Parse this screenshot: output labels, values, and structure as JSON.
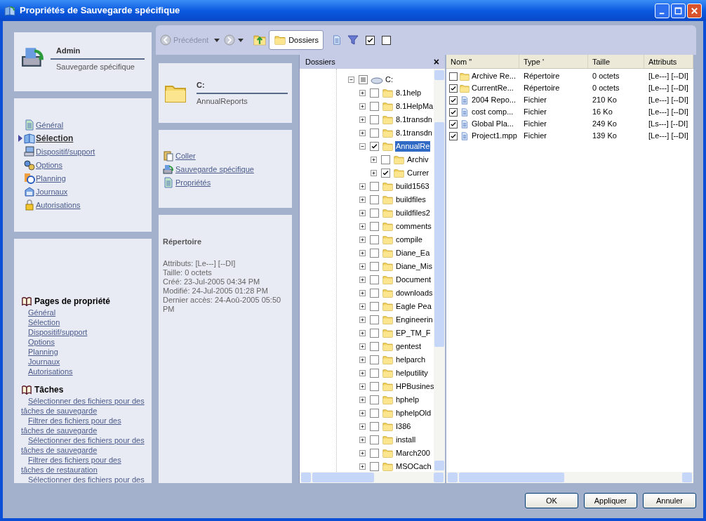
{
  "window": {
    "title": "Propriétés de Sauvegarde spécifique"
  },
  "header_card": {
    "title": "Admin",
    "subtitle": "Sauvegarde spécifique"
  },
  "nav": {
    "items": [
      {
        "label": "Général",
        "selected": false
      },
      {
        "label": "Sélection",
        "selected": true
      },
      {
        "label": "Dispositif/support",
        "selected": false
      },
      {
        "label": "Options",
        "selected": false
      },
      {
        "label": "Planning",
        "selected": false
      },
      {
        "label": "Journaux",
        "selected": false
      },
      {
        "label": "Autorisations",
        "selected": false
      }
    ]
  },
  "help": {
    "sections": [
      {
        "title": "Pages de propriété",
        "links": [
          "Général",
          "Sélection",
          "Dispositif/support",
          "Options",
          "Planning",
          "Journaux",
          "Autorisations"
        ]
      },
      {
        "title": "Tâches",
        "links": [
          "Sélectionner des fichiers pour des tâches de sauvegarde",
          "Filtrer des fichiers pour des tâches de sauvegarde",
          "Sélectionner des fichiers pour des tâches de sauvegarde",
          "Filtrer des fichiers pour des tâches de restauration",
          "Sélectionner des fichiers pour des"
        ]
      }
    ]
  },
  "toolbar": {
    "back": {
      "label": "Précédent",
      "disabled": true
    },
    "folders_button": {
      "label": "Dossiers",
      "selected": true
    },
    "checkboxes": [
      {
        "checked": true
      },
      {
        "checked": false
      }
    ]
  },
  "location_card": {
    "title": "C:",
    "subtitle": "AnnualReports"
  },
  "actions": [
    "Coller",
    "Sauvegarde spécifique",
    "Propriétés"
  ],
  "details": {
    "title": "Répertoire",
    "lines": [
      "Attributs: [Le---] [--DI]",
      "Taille: 0 octets",
      "Créé: 23-Jul-2005 04:34 PM",
      "Modifié: 24-Jul-2005 01:28 PM",
      "Dernier accès: 24-Aoû-2005 05:50 PM"
    ]
  },
  "folders_pane": {
    "title": "Dossiers",
    "close": "×",
    "tree": [
      {
        "label": "C:",
        "kind": "drive",
        "checked": false,
        "partial": true,
        "expanded": true,
        "selected": false,
        "children": [
          {
            "label": "8.1help",
            "kind": "folder",
            "checked": false,
            "partial": false,
            "expanded": false,
            "selected": false
          },
          {
            "label": "8.1HelpMa",
            "kind": "folder",
            "checked": false,
            "partial": false,
            "expanded": false,
            "selected": false
          },
          {
            "label": "8.1transdn",
            "kind": "folder",
            "checked": false,
            "partial": false,
            "expanded": false,
            "selected": false
          },
          {
            "label": "8.1transdn",
            "kind": "folder",
            "checked": false,
            "partial": false,
            "expanded": false,
            "selected": false
          },
          {
            "label": "AnnualRe",
            "kind": "folder",
            "checked": true,
            "partial": false,
            "expanded": true,
            "selected": true,
            "children": [
              {
                "label": "Archiv",
                "kind": "folder",
                "checked": false,
                "partial": false,
                "expanded": false,
                "selected": false
              },
              {
                "label": "Currer",
                "kind": "folder",
                "checked": true,
                "partial": false,
                "expanded": false,
                "selected": false
              }
            ]
          },
          {
            "label": "build1563",
            "kind": "folder",
            "checked": false,
            "partial": false,
            "expanded": false,
            "selected": false
          },
          {
            "label": "buildfiles",
            "kind": "folder",
            "checked": false,
            "partial": false,
            "expanded": false,
            "selected": false
          },
          {
            "label": "buildfiles2",
            "kind": "folder",
            "checked": false,
            "partial": false,
            "expanded": false,
            "selected": false
          },
          {
            "label": "comments",
            "kind": "folder",
            "checked": false,
            "partial": false,
            "expanded": false,
            "selected": false
          },
          {
            "label": "compile",
            "kind": "folder",
            "checked": false,
            "partial": false,
            "expanded": false,
            "selected": false
          },
          {
            "label": "Diane_Ea",
            "kind": "folder",
            "checked": false,
            "partial": false,
            "expanded": false,
            "selected": false
          },
          {
            "label": "Diane_Mis",
            "kind": "folder",
            "checked": false,
            "partial": false,
            "expanded": false,
            "selected": false
          },
          {
            "label": "Document",
            "kind": "folder",
            "checked": false,
            "partial": false,
            "expanded": false,
            "selected": false
          },
          {
            "label": "downloads",
            "kind": "folder",
            "checked": false,
            "partial": false,
            "expanded": false,
            "selected": false
          },
          {
            "label": "Eagle Pea",
            "kind": "folder",
            "checked": false,
            "partial": false,
            "expanded": false,
            "selected": false
          },
          {
            "label": "Engineerin",
            "kind": "folder",
            "checked": false,
            "partial": false,
            "expanded": false,
            "selected": false
          },
          {
            "label": "EP_TM_F",
            "kind": "folder",
            "checked": false,
            "partial": false,
            "expanded": false,
            "selected": false
          },
          {
            "label": "gentest",
            "kind": "folder",
            "checked": false,
            "partial": false,
            "expanded": false,
            "selected": false
          },
          {
            "label": "helparch",
            "kind": "folder",
            "checked": false,
            "partial": false,
            "expanded": false,
            "selected": false
          },
          {
            "label": "helputility",
            "kind": "folder",
            "checked": false,
            "partial": false,
            "expanded": false,
            "selected": false
          },
          {
            "label": "HPBusines",
            "kind": "folder",
            "checked": false,
            "partial": false,
            "expanded": false,
            "selected": false
          },
          {
            "label": "hphelp",
            "kind": "folder",
            "checked": false,
            "partial": false,
            "expanded": false,
            "selected": false
          },
          {
            "label": "hphelpOld",
            "kind": "folder",
            "checked": false,
            "partial": false,
            "expanded": false,
            "selected": false
          },
          {
            "label": "I386",
            "kind": "folder",
            "checked": false,
            "partial": false,
            "expanded": false,
            "selected": false
          },
          {
            "label": "install",
            "kind": "folder",
            "checked": false,
            "partial": false,
            "expanded": false,
            "selected": false
          },
          {
            "label": "March200",
            "kind": "folder",
            "checked": false,
            "partial": false,
            "expanded": false,
            "selected": false
          },
          {
            "label": "MSOCach",
            "kind": "folder",
            "checked": false,
            "partial": false,
            "expanded": false,
            "selected": false
          }
        ]
      }
    ]
  },
  "file_list": {
    "columns": [
      "Nom \"",
      "Type '",
      "Taille",
      "Attributs"
    ],
    "rows": [
      {
        "checked": false,
        "kind": "folder",
        "cells": [
          "Archive Re...",
          "Répertoire",
          "0 octets",
          "[Le---] [--DI]"
        ]
      },
      {
        "checked": true,
        "kind": "folder",
        "cells": [
          "CurrentRe...",
          "Répertoire",
          "0 octets",
          "[Le---] [--DI]"
        ]
      },
      {
        "checked": true,
        "kind": "file",
        "cells": [
          "2004 Repo...",
          "Fichier",
          "210 Ko",
          "[Le---] [--DI]"
        ]
      },
      {
        "checked": true,
        "kind": "file",
        "cells": [
          "cost comp...",
          "Fichier",
          "16 Ko",
          "[Le---] [--DI]"
        ]
      },
      {
        "checked": true,
        "kind": "file",
        "cells": [
          "Global Pla...",
          "Fichier",
          "249 Ko",
          "[Ls---] [--DI]"
        ]
      },
      {
        "checked": true,
        "kind": "file",
        "cells": [
          "Project1.mpp",
          "Fichier",
          "139 Ko",
          "[Le---] [--DI]"
        ]
      }
    ]
  },
  "buttons": [
    "OK",
    "Appliquer",
    "Annuler"
  ]
}
